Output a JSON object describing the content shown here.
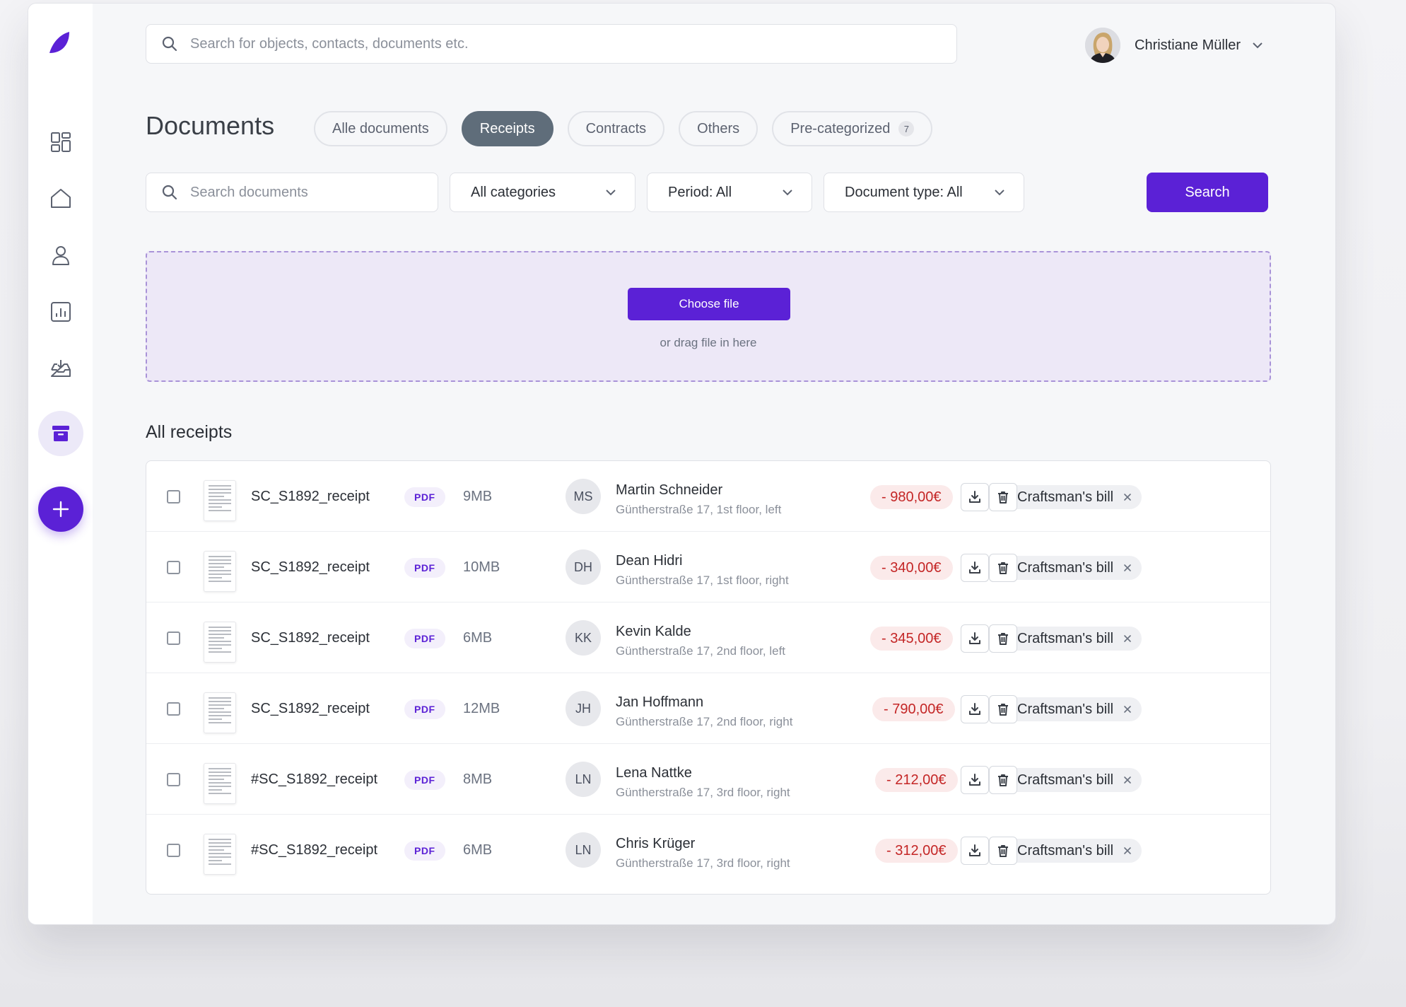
{
  "topbar": {
    "search_placeholder": "Search for objects, contacts, documents etc.",
    "user_name": "Christiane Müller"
  },
  "sidebar": {
    "items": [
      {
        "name": "dashboard-icon"
      },
      {
        "name": "home-icon"
      },
      {
        "name": "user-icon"
      },
      {
        "name": "chart-icon"
      },
      {
        "name": "inbox-icon"
      },
      {
        "name": "archive-icon",
        "active": true
      }
    ],
    "add_icon": "plus-icon"
  },
  "page": {
    "title": "Documents",
    "tabs": [
      {
        "label": "Alle documents"
      },
      {
        "label": "Receipts",
        "active": true
      },
      {
        "label": "Contracts"
      },
      {
        "label": "Others"
      },
      {
        "label": "Pre-categorized",
        "count": "7"
      }
    ]
  },
  "filters": {
    "search_placeholder": "Search documents",
    "category": "All categories",
    "period": "Period: All",
    "doc_type": "Document type: All",
    "search_button": "Search"
  },
  "upload": {
    "button": "Choose file",
    "hint": "or drag file in here"
  },
  "receipts": {
    "title": "All receipts",
    "rows": [
      {
        "file": "SC_S1892_receipt",
        "type": "PDF",
        "size": "9MB",
        "initials": "MS",
        "name": "Martin Schneider",
        "address": "Güntherstraße 17, 1st floor, left",
        "amount": "- 980,00€",
        "tag": "Craftsman's bill"
      },
      {
        "file": "SC_S1892_receipt",
        "type": "PDF",
        "size": "10MB",
        "initials": "DH",
        "name": "Dean Hidri",
        "address": "Güntherstraße 17, 1st floor, right",
        "amount": "- 340,00€",
        "tag": "Craftsman's bill"
      },
      {
        "file": "SC_S1892_receipt",
        "type": "PDF",
        "size": "6MB",
        "initials": "KK",
        "name": "Kevin Kalde",
        "address": "Güntherstraße 17, 2nd floor, left",
        "amount": "- 345,00€",
        "tag": "Craftsman's bill"
      },
      {
        "file": "SC_S1892_receipt",
        "type": "PDF",
        "size": "12MB",
        "initials": "JH",
        "name": "Jan Hoffmann",
        "address": "Güntherstraße 17, 2nd floor, right",
        "amount": "- 790,00€",
        "tag": "Craftsman's bill"
      },
      {
        "file": "#SC_S1892_receipt",
        "type": "PDF",
        "size": "8MB",
        "initials": "LN",
        "name": "Lena Nattke",
        "address": "Güntherstraße 17, 3rd floor, right",
        "amount": "- 212,00€",
        "tag": "Craftsman's bill"
      },
      {
        "file": "#SC_S1892_receipt",
        "type": "PDF",
        "size": "6MB",
        "initials": "LN",
        "name": "Chris Krüger",
        "address": "Güntherstraße 17, 3rd floor, right",
        "amount": "- 312,00€",
        "tag": "Craftsman's bill"
      }
    ]
  },
  "colors": {
    "accent": "#5b21d6",
    "tab_active": "#5f6d7a",
    "amount_text": "#c42626",
    "amount_bg": "#fbeaea",
    "dropzone_bg": "#ede8f7"
  }
}
